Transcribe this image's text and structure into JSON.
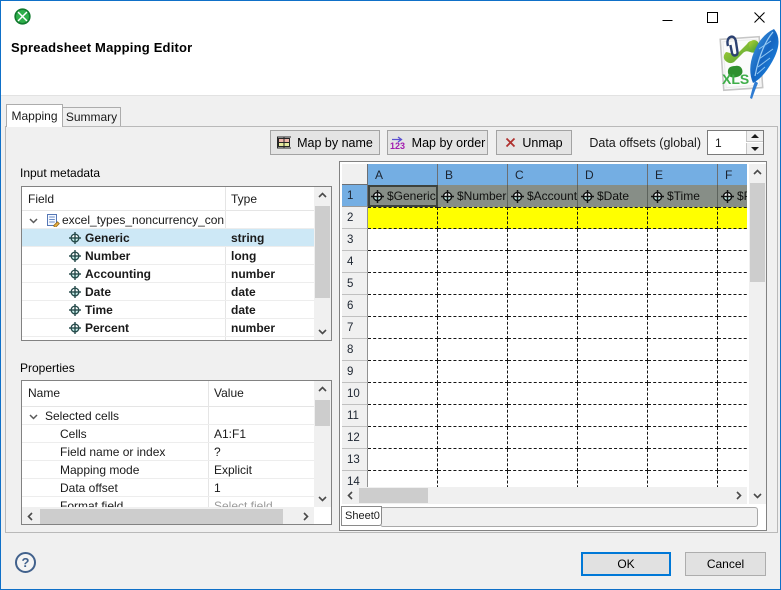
{
  "window": {
    "app_icon": "clover-icon",
    "title_text": "",
    "controls": {
      "minimize": "minimize",
      "maximize": "maximize",
      "close": "close"
    }
  },
  "header": {
    "title": "Spreadsheet Mapping Editor",
    "file_icon": "xls-file-icon",
    "file_icon_label": "XLS"
  },
  "tabs": [
    {
      "label": "Mapping",
      "active": true
    },
    {
      "label": "Summary",
      "active": false
    }
  ],
  "toolbar": {
    "map_by_name_label": "Map by name",
    "map_by_order_label": "Map by order",
    "unmap_label": "Unmap",
    "data_offsets_label": "Data offsets (global)",
    "data_offsets_value": "1"
  },
  "input_metadata": {
    "label": "Input metadata",
    "columns": [
      "Field",
      "Type"
    ],
    "root": "excel_types_noncurrency_con",
    "fields": [
      {
        "name": "Generic",
        "type": "string",
        "selected": true
      },
      {
        "name": "Number",
        "type": "long",
        "selected": false
      },
      {
        "name": "Accounting",
        "type": "number",
        "selected": false
      },
      {
        "name": "Date",
        "type": "date",
        "selected": false
      },
      {
        "name": "Time",
        "type": "date",
        "selected": false
      },
      {
        "name": "Percent",
        "type": "number",
        "selected": false
      }
    ]
  },
  "properties": {
    "label": "Properties",
    "columns": [
      "Name",
      "Value"
    ],
    "group": "Selected cells",
    "rows": [
      {
        "name": "Cells",
        "value": "A1:F1"
      },
      {
        "name": "Field name or index",
        "value": "?"
      },
      {
        "name": "Mapping mode",
        "value": "Explicit"
      },
      {
        "name": "Data offset",
        "value": "1"
      },
      {
        "name": "Format field",
        "value": "Select field"
      }
    ]
  },
  "spreadsheet": {
    "columns": [
      "A",
      "B",
      "C",
      "D",
      "E",
      "F"
    ],
    "row_count": 14,
    "mapped_cells": [
      "$Generic",
      "$Number",
      "$Accounting",
      "$Date",
      "$Time",
      "$Percent"
    ],
    "mapped_row": "1",
    "highlighted_row": "2",
    "sheet_tab": "Sheet0",
    "colors": {
      "header_blue": "#74aee3",
      "mapped_gray": "#878e87",
      "highlight_yellow": "#ffff00"
    }
  },
  "footer": {
    "help": "?",
    "ok_label": "OK",
    "cancel_label": "Cancel"
  }
}
